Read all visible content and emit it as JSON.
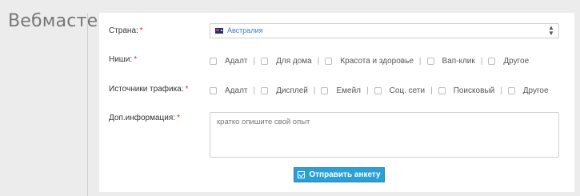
{
  "section_title": "Вебмастер",
  "country": {
    "label": "Страна:",
    "required": "*",
    "selected": "Австралия",
    "flag_icon": "australia-flag-icon"
  },
  "niches": {
    "label": "Ниши:",
    "required": "*",
    "options": [
      "Адалт",
      "Для дома",
      "Красота и здоровье",
      "Вап-клик",
      "Другое"
    ]
  },
  "traffic": {
    "label": "Источники трафика:",
    "required": "*",
    "options": [
      "Адалт",
      "Дисплей",
      "Емейл",
      "Соц. сети",
      "Поисковый",
      "Другое"
    ]
  },
  "info": {
    "label": "Доп.информация:",
    "required": "*",
    "placeholder": "кратко опишите свой опыт"
  },
  "submit": {
    "label": "Отправить анкету",
    "icon": "check-square-icon"
  },
  "colors": {
    "accent": "#2aa0d6",
    "required": "#e0262b",
    "link": "#3a7fc0"
  }
}
